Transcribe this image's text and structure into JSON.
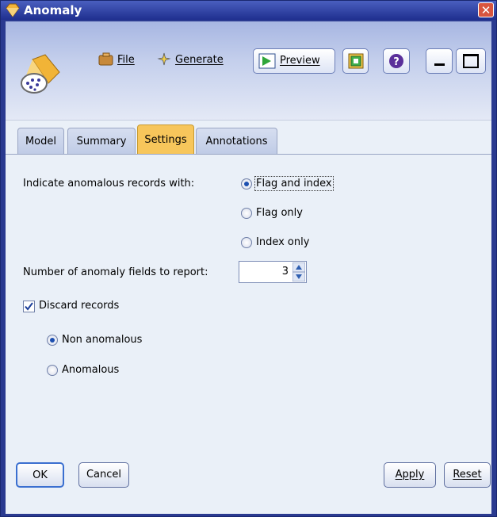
{
  "window": {
    "title": "Anomaly"
  },
  "toolbar": {
    "file_label": "File",
    "generate_label": "Generate",
    "preview_label": "Preview"
  },
  "tabs": [
    {
      "label": "Model",
      "active": false
    },
    {
      "label": "Summary",
      "active": false
    },
    {
      "label": "Settings",
      "active": true
    },
    {
      "label": "Annotations",
      "active": false
    }
  ],
  "settings": {
    "indicate_label": "Indicate anomalous records with:",
    "indicate_options": [
      {
        "label": "Flag and index",
        "selected": true
      },
      {
        "label": "Flag only",
        "selected": false
      },
      {
        "label": "Index only",
        "selected": false
      }
    ],
    "num_fields_label": "Number of anomaly fields to report:",
    "num_fields_value": "3",
    "discard_label": "Discard records",
    "discard_checked": true,
    "discard_options": [
      {
        "label": "Non anomalous",
        "selected": true
      },
      {
        "label": "Anomalous",
        "selected": false
      }
    ]
  },
  "buttons": {
    "ok": "OK",
    "cancel": "Cancel",
    "apply": "Apply",
    "reset": "Reset"
  },
  "colors": {
    "titlebar": "#2a3a90",
    "active_tab": "#f7c65b",
    "panel_bg": "#eaf0f8"
  },
  "icons": [
    "diamond-node-icon",
    "close-icon",
    "file-icon",
    "generate-icon",
    "preview-icon",
    "export-icon",
    "help-icon",
    "minimize-icon",
    "maximize-icon",
    "spinner-up-icon",
    "spinner-down-icon",
    "check-icon"
  ]
}
